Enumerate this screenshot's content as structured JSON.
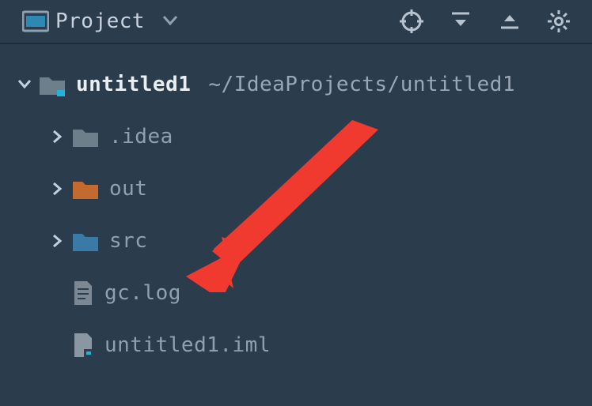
{
  "toolbar": {
    "title": "Project"
  },
  "tree": {
    "root": {
      "name": "untitled1",
      "path": "~/IdeaProjects/untitled1"
    },
    "children": [
      {
        "name": ".idea",
        "type": "folder",
        "color": "gray",
        "expandable": true
      },
      {
        "name": "out",
        "type": "folder",
        "color": "orange",
        "expandable": true
      },
      {
        "name": "src",
        "type": "folder",
        "color": "blue",
        "expandable": true
      },
      {
        "name": "gc.log",
        "type": "file",
        "icon": "text",
        "expandable": false
      },
      {
        "name": "untitled1.iml",
        "type": "file",
        "icon": "iml",
        "expandable": false
      }
    ]
  },
  "colors": {
    "folder_gray": "#6F7E8B",
    "folder_orange": "#C56A2E",
    "folder_blue": "#3A7AA6",
    "accent_cyan": "#1FB4D8",
    "arrow_red": "#F03A2F"
  }
}
